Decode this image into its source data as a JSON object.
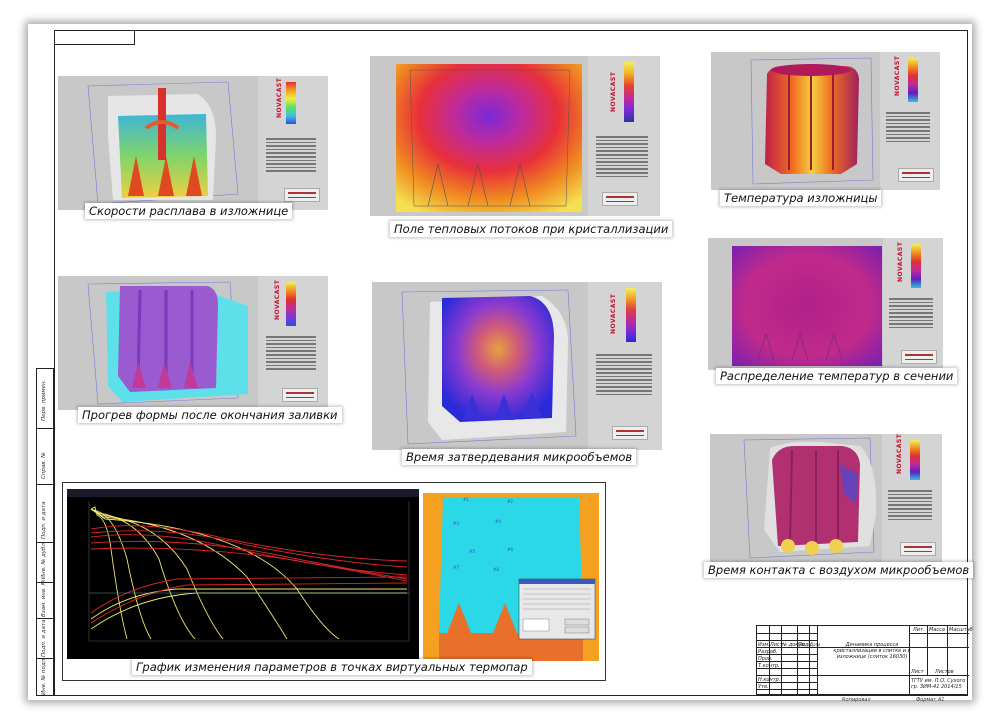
{
  "captions": {
    "melt_velocity": "Скорости расплава в изложнице",
    "heat_flux": "Поле тепловых потоков при кристаллизации",
    "mold_temperature": "Температура изложницы",
    "mold_preheat": "Прогрев формы после окончания заливки",
    "solidification_time": "Время затвердевания микрообъемов",
    "section_temperature": "Распределение температур в сечении",
    "air_contact_time": "Время контакта с воздухом микрообъемов",
    "thermocouple_graph": "График изменения параметров в точках виртуальных термопар"
  },
  "brand": "NOVACAST",
  "colors": {
    "sheet_bg": "#ffffff",
    "panel_bg": "#c8c8c8",
    "graph_bg": "#000000",
    "curve_yellow": "#f2e86a",
    "curve_red": "#d8262a",
    "brand_red": "#c8102e"
  },
  "stamp": {
    "title": "Динамика процесса кристаллизации в слитке и в изложнице (слиток 16030)",
    "lit": "Лит.",
    "mass": "Масса",
    "scale": "Масштаб",
    "sheet": "Лист",
    "sheets": "Листов",
    "org": "ТГТУ им. П.О. Сухого гр. ЗИМ-41 2014/15",
    "copied": "Копировал",
    "format": "Формат A1",
    "rows": [
      "Изм.",
      "Лист",
      "№ докум.",
      "Подп.",
      "Дата",
      "Разраб.",
      "Пров.",
      "Т.контр.",
      "Н.контр.",
      "Утв."
    ]
  },
  "left_stamp": [
    "Перв. примен.",
    "Справ. №",
    "Подп. и дата",
    "Инв. № дубл.",
    "Взам. инв. №",
    "Подп. и дата",
    "Инв. № подл."
  ]
}
